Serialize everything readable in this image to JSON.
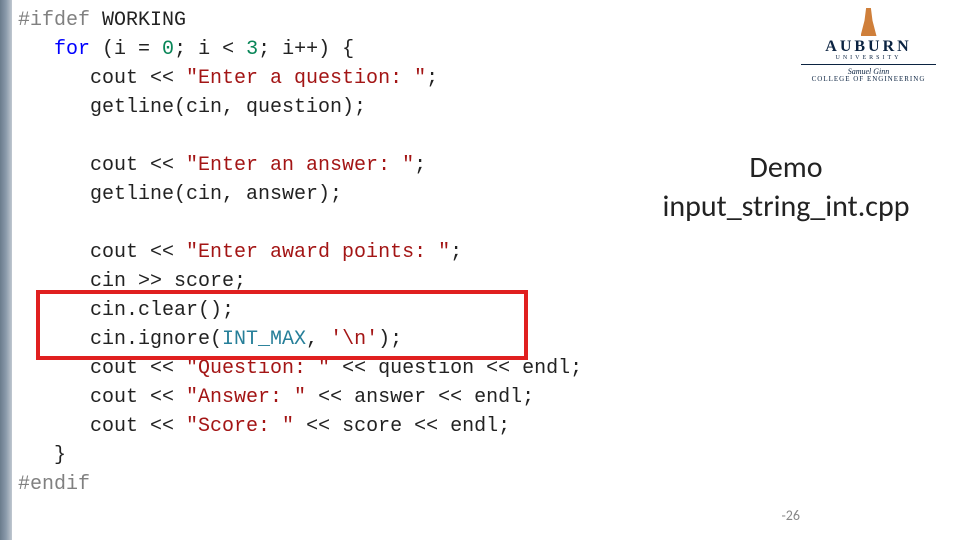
{
  "code": {
    "l1a": "#ifdef",
    "l1b": " WORKING",
    "l2a": "   ",
    "l2b": "for",
    "l2c": " (i = ",
    "l2d": "0",
    "l2e": "; i < ",
    "l2f": "3",
    "l2g": "; i++) {",
    "l3a": "      cout << ",
    "l3b": "\"Enter a question: \"",
    "l3c": ";",
    "l4a": "      getline(cin, question);",
    "blank1": " ",
    "l6a": "      cout << ",
    "l6b": "\"Enter an answer: \"",
    "l6c": ";",
    "l7a": "      getline(cin, answer);",
    "blank2": " ",
    "l9a": "      cout << ",
    "l9b": "\"Enter award points: \"",
    "l9c": ";",
    "l10a": "      cin >> score;",
    "l11a": "      cin.clear();",
    "l12a": "      cin.ignore(",
    "l12b": "INT_MAX",
    "l12c": ", ",
    "l12d": "'\\n'",
    "l12e": ");",
    "l13a": "      cout << ",
    "l13b": "\"Question: \"",
    "l13c": " << question << endl;",
    "l14a": "      cout << ",
    "l14b": "\"Answer: \"",
    "l14c": " << answer << endl;",
    "l15a": "      cout << ",
    "l15b": "\"Score: \"",
    "l15c": " << score << endl;",
    "l16": "   }",
    "l17": "#endif"
  },
  "demo": {
    "line1": "Demo",
    "line2": "input_string_int.cpp"
  },
  "page_number": "-26",
  "logo": {
    "name": "AUBURN",
    "university": "UNIVERSITY",
    "sub1": "Samuel Ginn",
    "sub2": "COLLEGE OF ENGINEERING"
  }
}
